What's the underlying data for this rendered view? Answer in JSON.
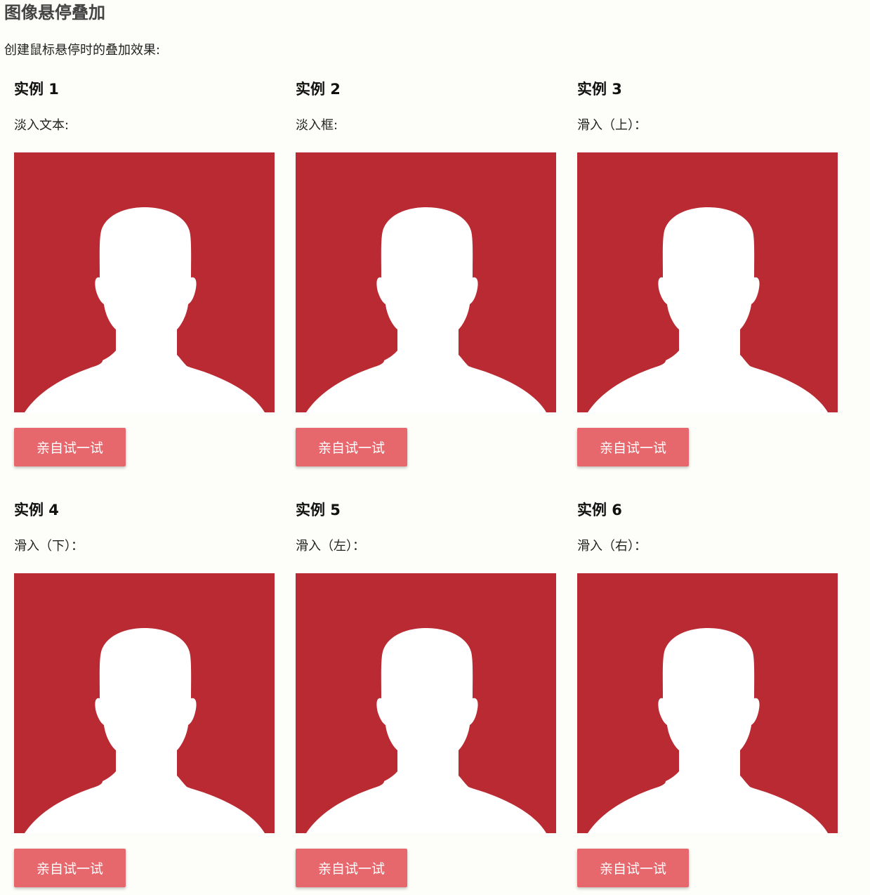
{
  "page": {
    "title": "图像悬停叠加",
    "description": "创建鼠标悬停时的叠加效果:"
  },
  "colors": {
    "image_background": "#ba2a33",
    "button_background": "#e7686c",
    "button_text": "#ffffff",
    "page_background": "#fdfdf9"
  },
  "examples": [
    {
      "title": "实例 1",
      "description": "淡入文本:",
      "image_icon": "person-silhouette-icon",
      "button_label": "亲自试一试"
    },
    {
      "title": "实例 2",
      "description": "淡入框:",
      "image_icon": "person-silhouette-icon",
      "button_label": "亲自试一试"
    },
    {
      "title": "实例 3",
      "description": "滑入（上）：",
      "image_icon": "person-silhouette-icon",
      "button_label": "亲自试一试"
    },
    {
      "title": "实例 4",
      "description": "滑入（下）：",
      "image_icon": "person-silhouette-icon",
      "button_label": "亲自试一试"
    },
    {
      "title": "实例 5",
      "description": "滑入（左）：",
      "image_icon": "person-silhouette-icon",
      "button_label": "亲自试一试"
    },
    {
      "title": "实例 6",
      "description": "滑入（右）：",
      "image_icon": "person-silhouette-icon",
      "button_label": "亲自试一试"
    }
  ]
}
